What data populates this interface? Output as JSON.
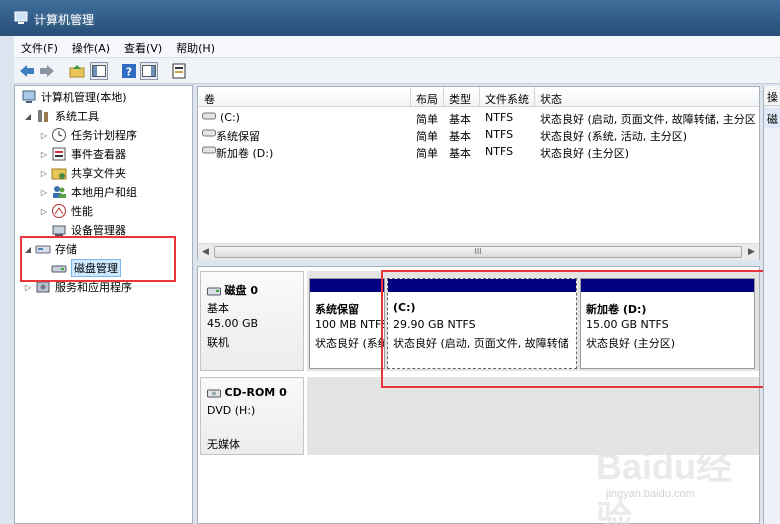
{
  "window": {
    "title": "计算机管理"
  },
  "menu": [
    "文件(F)",
    "操作(A)",
    "查看(V)",
    "帮助(H)"
  ],
  "tree": {
    "root": "计算机管理(本地)",
    "system_tools": "系统工具",
    "task_scheduler": "任务计划程序",
    "event_viewer": "事件查看器",
    "shared_folders": "共享文件夹",
    "local_users": "本地用户和组",
    "performance": "性能",
    "device_manager": "设备管理器",
    "storage": "存储",
    "disk_management": "磁盘管理",
    "services_apps": "服务和应用程序"
  },
  "volume_list": {
    "headers": [
      "卷",
      "布局",
      "类型",
      "文件系统",
      "状态"
    ],
    "rows": [
      [
        "(C:)",
        "简单",
        "基本",
        "NTFS",
        "状态良好 (启动, 页面文件, 故障转储, 主分区"
      ],
      [
        "系统保留",
        "简单",
        "基本",
        "NTFS",
        "状态良好 (系统, 活动, 主分区)"
      ],
      [
        "新加卷 (D:)",
        "简单",
        "基本",
        "NTFS",
        "状态良好 (主分区)"
      ]
    ],
    "scroll_grip": "III"
  },
  "disk0": {
    "name": "磁盘 0",
    "type": "基本",
    "size": "45.00 GB",
    "status": "联机"
  },
  "partitions": [
    {
      "name": "系统保留",
      "size": "100 MB NTFS",
      "status": "状态良好 (系统"
    },
    {
      "name": "(C:)",
      "size": "29.90 GB NTFS",
      "status": "状态良好 (启动, 页面文件, 故障转储"
    },
    {
      "name": "新加卷  (D:)",
      "size": "15.00 GB NTFS",
      "status": "状态良好 (主分区)"
    }
  ],
  "cdrom": {
    "name": "CD-ROM 0",
    "drive": "DVD (H:)",
    "status": "无媒体"
  },
  "actions_pane": {
    "header": "操",
    "item": "磁"
  },
  "watermark": {
    "brand": "Baidu经验",
    "url": "jingyan.baidu.com"
  },
  "colors": {
    "highlight_box": "#e8363b",
    "partition_bar": "#000080",
    "titlebar": "#2f5a85"
  }
}
